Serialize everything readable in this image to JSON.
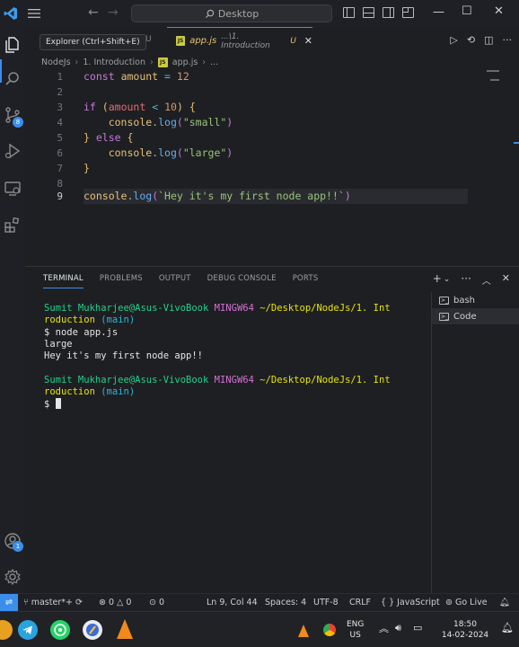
{
  "titlebar": {
    "search_label": "Desktop"
  },
  "activity": {
    "source_control_badge": "8",
    "accounts_badge": "1"
  },
  "tabs": {
    "tooltip": "Explorer (Ctrl+Shift+E)",
    "inactive_tab_status": "U",
    "active": {
      "name": "app.js",
      "path": "...\\1. Introduction",
      "status": "U"
    }
  },
  "breadcrumb": [
    "NodeJs",
    "1. Introduction",
    "app.js",
    "..."
  ],
  "editor": {
    "line_numbers": [
      "1",
      "2",
      "3",
      "4",
      "5",
      "6",
      "7",
      "8",
      "9"
    ],
    "current_line": "9",
    "colors": {
      "keyword": "#c678dd",
      "variable": "#e5c07b",
      "number": "#d19a66",
      "string": "#98c379",
      "function": "#61afef"
    }
  },
  "panel": {
    "tabs": [
      "TERMINAL",
      "PROBLEMS",
      "OUTPUT",
      "DEBUG CONSOLE",
      "PORTS"
    ],
    "active_tab": "TERMINAL",
    "terminal_list": [
      {
        "label": "bash"
      },
      {
        "label": "Code"
      }
    ],
    "prompt": {
      "user": "Sumit Mukharjee@Asus-VivoBook",
      "env": "MINGW64",
      "path_part1": "~/Desktop/NodeJs/1. Int",
      "path_part2": "roduction",
      "branch": "(main)"
    },
    "command": "$ node app.js",
    "output": [
      "large",
      "Hey it's my first node app!!"
    ],
    "prompt_symbol": "$"
  },
  "statusbar": {
    "branch": "master*+",
    "errors": "0",
    "warnings": "0",
    "ports": "0",
    "position": "Ln 9, Col 44",
    "spaces": "Spaces: 4",
    "encoding": "UTF-8",
    "eol": "CRLF",
    "language": "{ } JavaScript",
    "golive": "Go Live"
  },
  "taskbar": {
    "language": "ENG",
    "region": "US",
    "time": "18:50",
    "date": "14-02-2024"
  }
}
